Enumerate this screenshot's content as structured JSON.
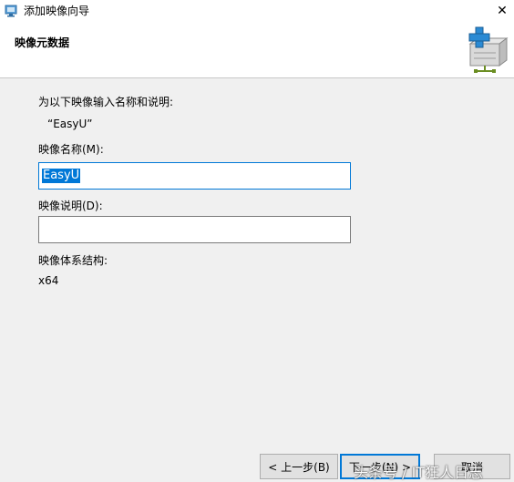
{
  "window": {
    "title": "添加映像向导",
    "close_glyph": "✕"
  },
  "header": {
    "title": "映像元数据",
    "icon": "add-image-package-icon"
  },
  "content": {
    "instruction": "为以下映像输入名称和说明:",
    "image_display_name": "“EasyU”",
    "name_label": "映像名称(M):",
    "name_value": "EasyU",
    "description_label": "映像说明(D):",
    "description_value": "",
    "architecture_label": "映像体系结构:",
    "architecture_value": "x64"
  },
  "buttons": {
    "back_label": "< 上一步(B)",
    "next_label": "下一步(N) >",
    "cancel_label": "取消"
  },
  "watermark": {
    "text": "头条号 / IT狂人日志"
  },
  "colors": {
    "accent": "#0078d7",
    "window_bg": "#f0f0f0",
    "header_bg": "#ffffff"
  }
}
